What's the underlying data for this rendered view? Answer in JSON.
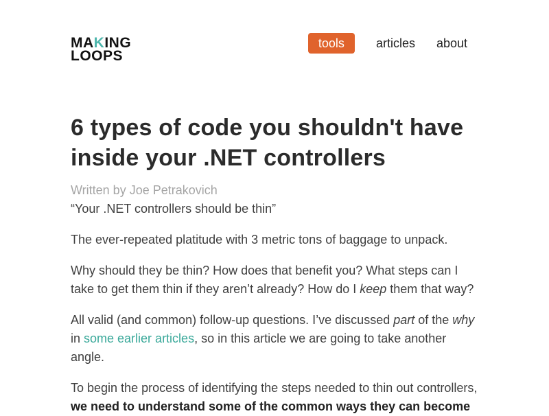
{
  "logo": {
    "line1_a": "MA",
    "line1_b": "K",
    "line1_c": "ING",
    "line2": "LOOPS"
  },
  "nav": {
    "tools": "tools",
    "articles": "articles",
    "about": "about"
  },
  "article": {
    "title": "6 types of code you shouldn't have inside your .NET controllers",
    "byline": "Written by Joe Petrakovich",
    "quote": "“Your .NET controllers should be thin”",
    "p1": "The ever-repeated platitude with 3 metric tons of baggage to unpack.",
    "p2a": "Why should they be thin? How does that benefit you? What steps can I take to get them thin if they aren’t already? How do I ",
    "p2_em": "keep",
    "p2b": " them that way?",
    "p3a": "All valid (and common) follow-up questions. I’ve discussed ",
    "p3_em1": "part",
    "p3b": " of the ",
    "p3_em2": "why",
    "p3c": " in ",
    "p3_link": "some earlier articles",
    "p3d": ", so in this article we are going to take another angle.",
    "p4a": "To begin the process of identifying the steps needed to thin out controllers, ",
    "p4_strong": "we need to understand some of the common ways they can become"
  }
}
